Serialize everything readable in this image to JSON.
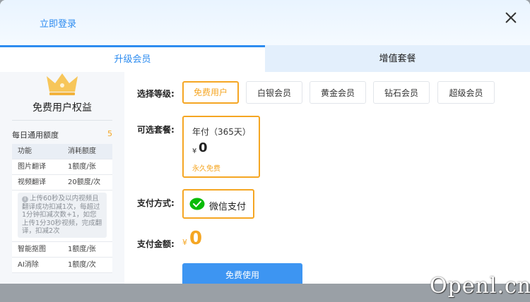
{
  "header": {
    "login_label": "立即登录",
    "close_icon": "close-icon"
  },
  "tabs": [
    {
      "label": "升级会员",
      "active": true
    },
    {
      "label": "增值套餐",
      "active": false
    }
  ],
  "sidebar": {
    "crown_icon": "crown-icon",
    "title": "免费用户权益",
    "quota_label": "每日通用额度",
    "quota_count": "5",
    "table_header": {
      "feature": "功能",
      "cost": "消耗额度"
    },
    "rows": [
      {
        "feature": "图片翻译",
        "cost": "1额度/张"
      },
      {
        "feature": "视频翻译",
        "cost": "20额度/次"
      },
      {
        "feature": "智能抠图",
        "cost": "1额度/张"
      },
      {
        "feature": "AI消除",
        "cost": "1额度/次"
      }
    ],
    "video_note": "上传60秒及以内视频且翻译成功扣减1次，每超过1分钟扣减次数+1，如您上传1分30秒视频，完成翻译，扣减2次"
  },
  "main": {
    "level_label": "选择等级:",
    "levels": [
      {
        "label": "免费用户",
        "active": true
      },
      {
        "label": "白银会员",
        "active": false
      },
      {
        "label": "黄金会员",
        "active": false
      },
      {
        "label": "钻石会员",
        "active": false
      },
      {
        "label": "超级会员",
        "active": false
      }
    ],
    "plan_label": "可选套餐:",
    "plan": {
      "name": "年付（365天）",
      "currency": "¥",
      "price": "0",
      "desc": "永久免费"
    },
    "pay_label": "支付方式:",
    "pay_method": "微信支付",
    "amount_label": "支付金额:",
    "amount_currency": "¥",
    "amount_value": "0",
    "submit_label": "免费使用"
  },
  "colors": {
    "accent": "#2d8cf0",
    "highlight": "#f5a623",
    "submit": "#3d95f2",
    "wechat": "#09bb07"
  },
  "watermark": "Openl.cn"
}
